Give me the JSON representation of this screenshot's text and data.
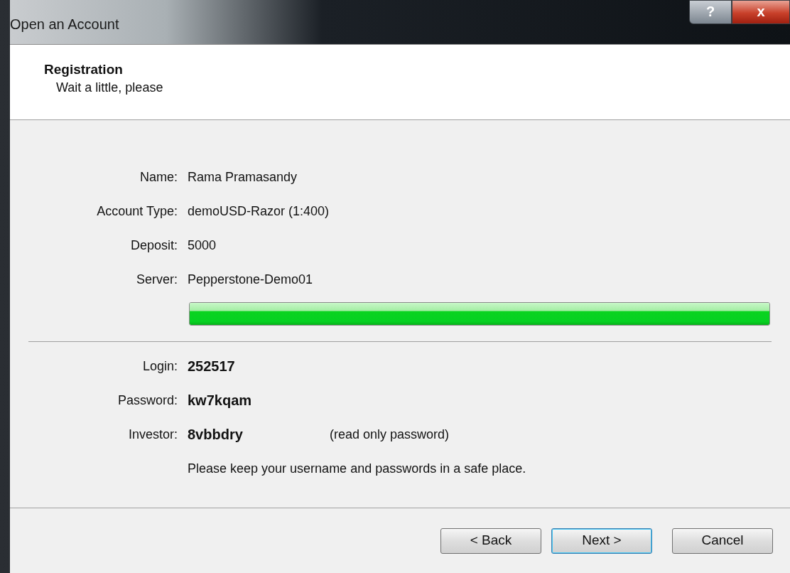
{
  "window": {
    "title": "Open an Account",
    "help_button": "?",
    "close_button": "x"
  },
  "header": {
    "title": "Registration",
    "subtitle": "Wait a little, please"
  },
  "details": [
    {
      "label": "Name:",
      "value": "Rama Pramasandy"
    },
    {
      "label": "Account Type:",
      "value": "demoUSD-Razor (1:400)"
    },
    {
      "label": "Deposit:",
      "value": "5000"
    },
    {
      "label": "Server:",
      "value": "Pepperstone-Demo01"
    }
  ],
  "progress": {
    "level": 1.0
  },
  "credentials": [
    {
      "label": "Login:",
      "value": "252517"
    },
    {
      "label": "Password:",
      "value": "kw7kqam"
    },
    {
      "label": "Investor:",
      "value": "8vbbdry",
      "note": "(read only password)"
    }
  ],
  "notice": "Please keep your username and passwords in a safe place.",
  "buttons": [
    {
      "label": "< Back",
      "default": false
    },
    {
      "label": "Next >",
      "default": true
    },
    {
      "label": "Cancel",
      "default": false
    }
  ]
}
